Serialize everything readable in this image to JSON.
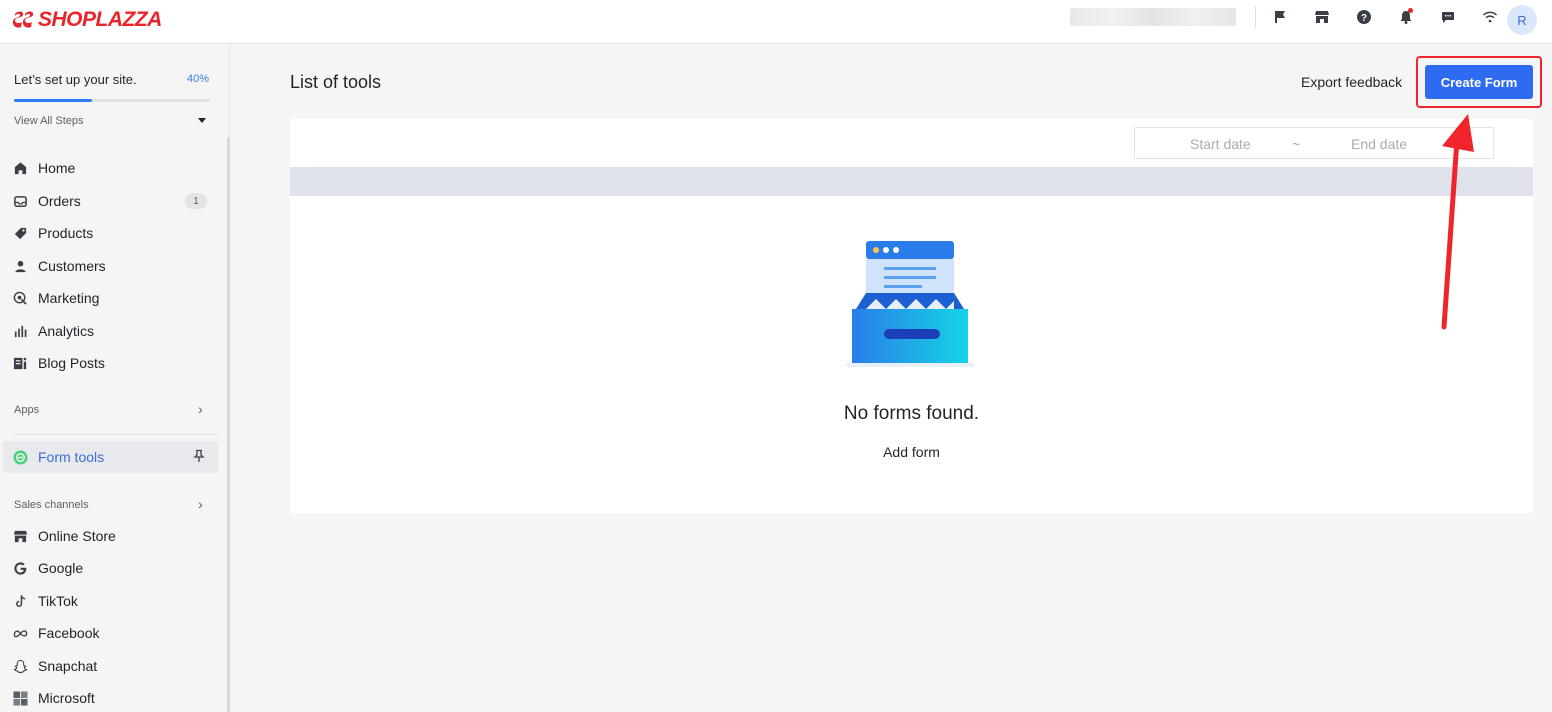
{
  "brand": {
    "name": "SHOPLAZZA",
    "color": "#e8252c"
  },
  "topbar": {
    "icons": [
      "flag-icon",
      "store-icon",
      "help-icon",
      "bell-icon",
      "chat-icon",
      "wifi-icon"
    ],
    "avatar_initial": "R"
  },
  "sidebar": {
    "setup": {
      "title": "Let’s set up your site.",
      "percent_label": "40%",
      "progress": 0.4,
      "view_steps": "View All Steps"
    },
    "main_nav": [
      {
        "label": "Home",
        "icon": "home-icon"
      },
      {
        "label": "Orders",
        "icon": "inbox-icon",
        "badge": "1"
      },
      {
        "label": "Products",
        "icon": "tag-icon"
      },
      {
        "label": "Customers",
        "icon": "person-icon"
      },
      {
        "label": "Marketing",
        "icon": "marketing-icon"
      },
      {
        "label": "Analytics",
        "icon": "bar-chart-icon"
      },
      {
        "label": "Blog Posts",
        "icon": "blog-icon"
      }
    ],
    "apps_label": "Apps",
    "active_app": {
      "label": "Form tools",
      "icon": "form-tools-icon"
    },
    "sales_channels_label": "Sales channels",
    "channels": [
      {
        "label": "Online Store",
        "icon": "store-icon"
      },
      {
        "label": "Google",
        "icon": "google-icon"
      },
      {
        "label": "TikTok",
        "icon": "tiktok-icon"
      },
      {
        "label": "Facebook",
        "icon": "meta-icon"
      },
      {
        "label": "Snapchat",
        "icon": "snapchat-icon"
      },
      {
        "label": "Microsoft",
        "icon": "microsoft-icon"
      }
    ]
  },
  "main": {
    "title": "List of tools",
    "export_label": "Export feedback",
    "create_label": "Create Form",
    "date_range": {
      "start_placeholder": "Start date",
      "separator": "~",
      "end_placeholder": "End date"
    },
    "empty": {
      "title": "No forms found.",
      "action": "Add form"
    }
  },
  "colors": {
    "accent": "#2f6bf1",
    "annotation": "#f0242b",
    "progress": "#2f7cf6"
  }
}
